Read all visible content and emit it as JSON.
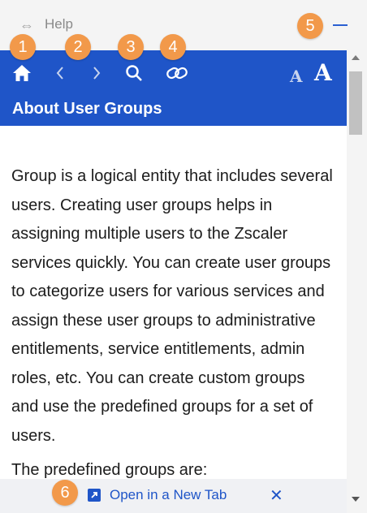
{
  "titlebar": {
    "title": "Help",
    "drag_icon": "resize-horizontal-icon",
    "minimize_icon": "minimize-icon"
  },
  "toolbar": {
    "home_icon": "home-icon",
    "back_icon": "chevron-left-icon",
    "forward_icon": "chevron-right-icon",
    "search_icon": "search-icon",
    "link_icon": "link-icon",
    "font_decrease": "A",
    "font_increase": "A"
  },
  "header": {
    "title": "About User Groups"
  },
  "content": {
    "paragraph1": "Group is a logical entity that includes several users. Creating user groups helps in assigning multiple users to the Zscaler services quickly. You can create user groups to categorize users for various services and assign these user groups to administrative entitlements, service entitlements, admin roles, etc. You can create custom groups and use the predefined groups for a set of users.",
    "paragraph2": "The predefined groups are:"
  },
  "footer": {
    "open_label": "Open in a New Tab",
    "close_label": "✕"
  },
  "badges": [
    "1",
    "2",
    "3",
    "4",
    "5",
    "6"
  ],
  "colors": {
    "accent": "#1f55c8",
    "badge": "#f2994a"
  }
}
